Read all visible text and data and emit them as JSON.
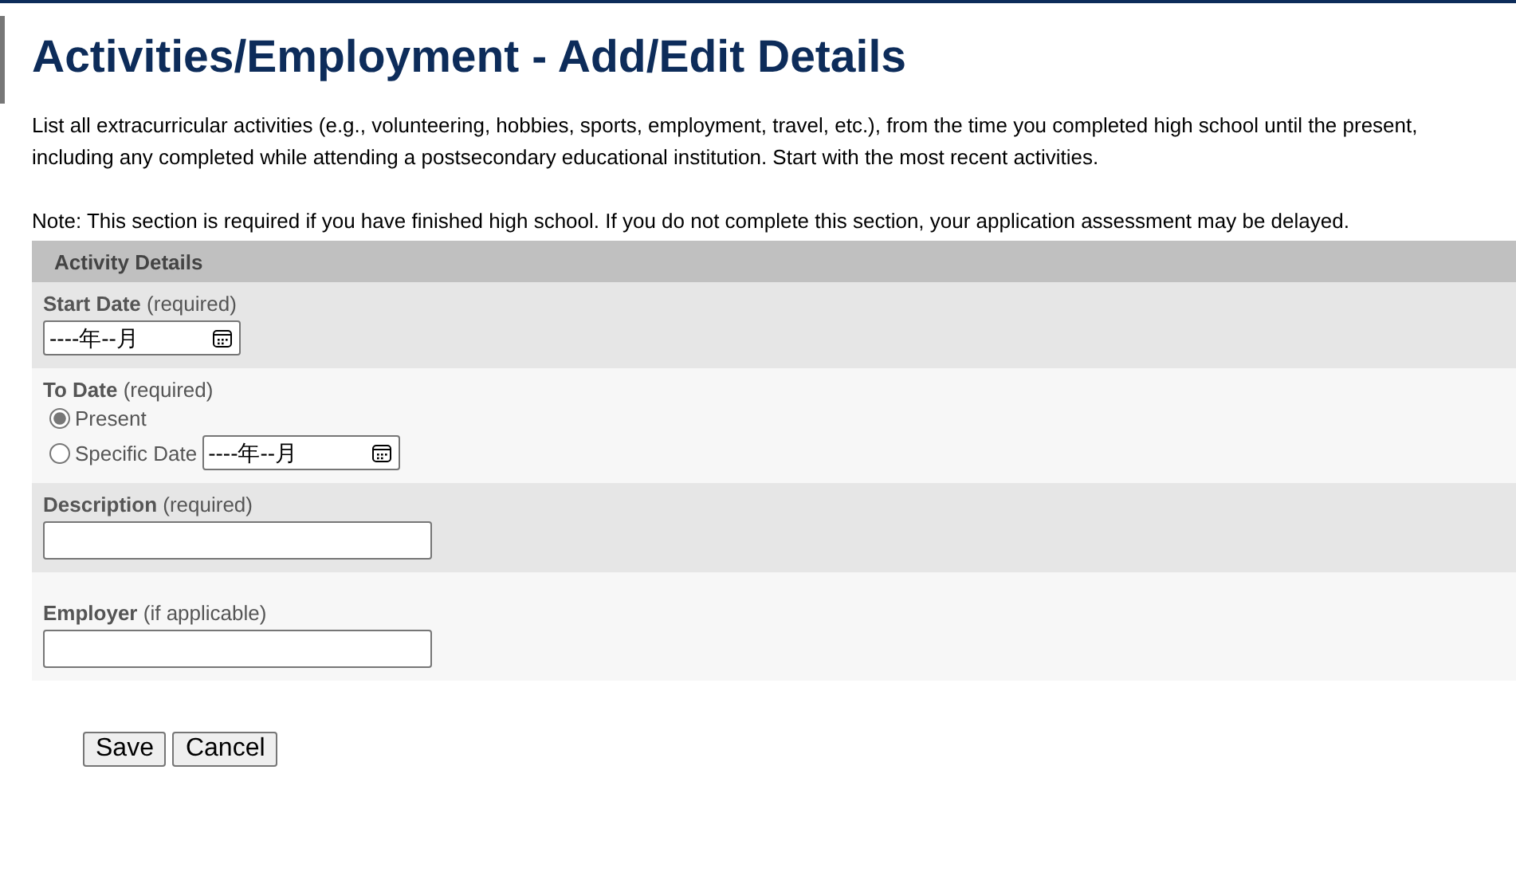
{
  "heading": "Activities/Employment - Add/Edit Details",
  "intro": "List all extracurricular activities (e.g., volunteering, hobbies, sports, employment, travel, etc.), from the time you completed high school until the present, including any completed while attending a postsecondary educational institution. Start with the most recent activities.",
  "note": "Note: This section is required if you have finished high school. If you do not complete this section, your application assessment may be delayed.",
  "section": {
    "title": "Activity Details",
    "rows": [
      {
        "kind": "date",
        "label": "Start Date",
        "hint": "(required)",
        "placeholder": "----年--月"
      },
      {
        "kind": "radio",
        "label": "To Date",
        "hint": "(required)",
        "options": [
          {
            "label": "Present",
            "selected": true
          },
          {
            "label": "Specific Date",
            "selected": false,
            "placeholder": "----年--月"
          }
        ]
      },
      {
        "kind": "text",
        "label": "Description",
        "hint": "(required)"
      },
      {
        "kind": "text",
        "label": "Employer",
        "hint": "(if applicable)"
      }
    ]
  },
  "buttons": [
    "Save",
    "Cancel"
  ]
}
